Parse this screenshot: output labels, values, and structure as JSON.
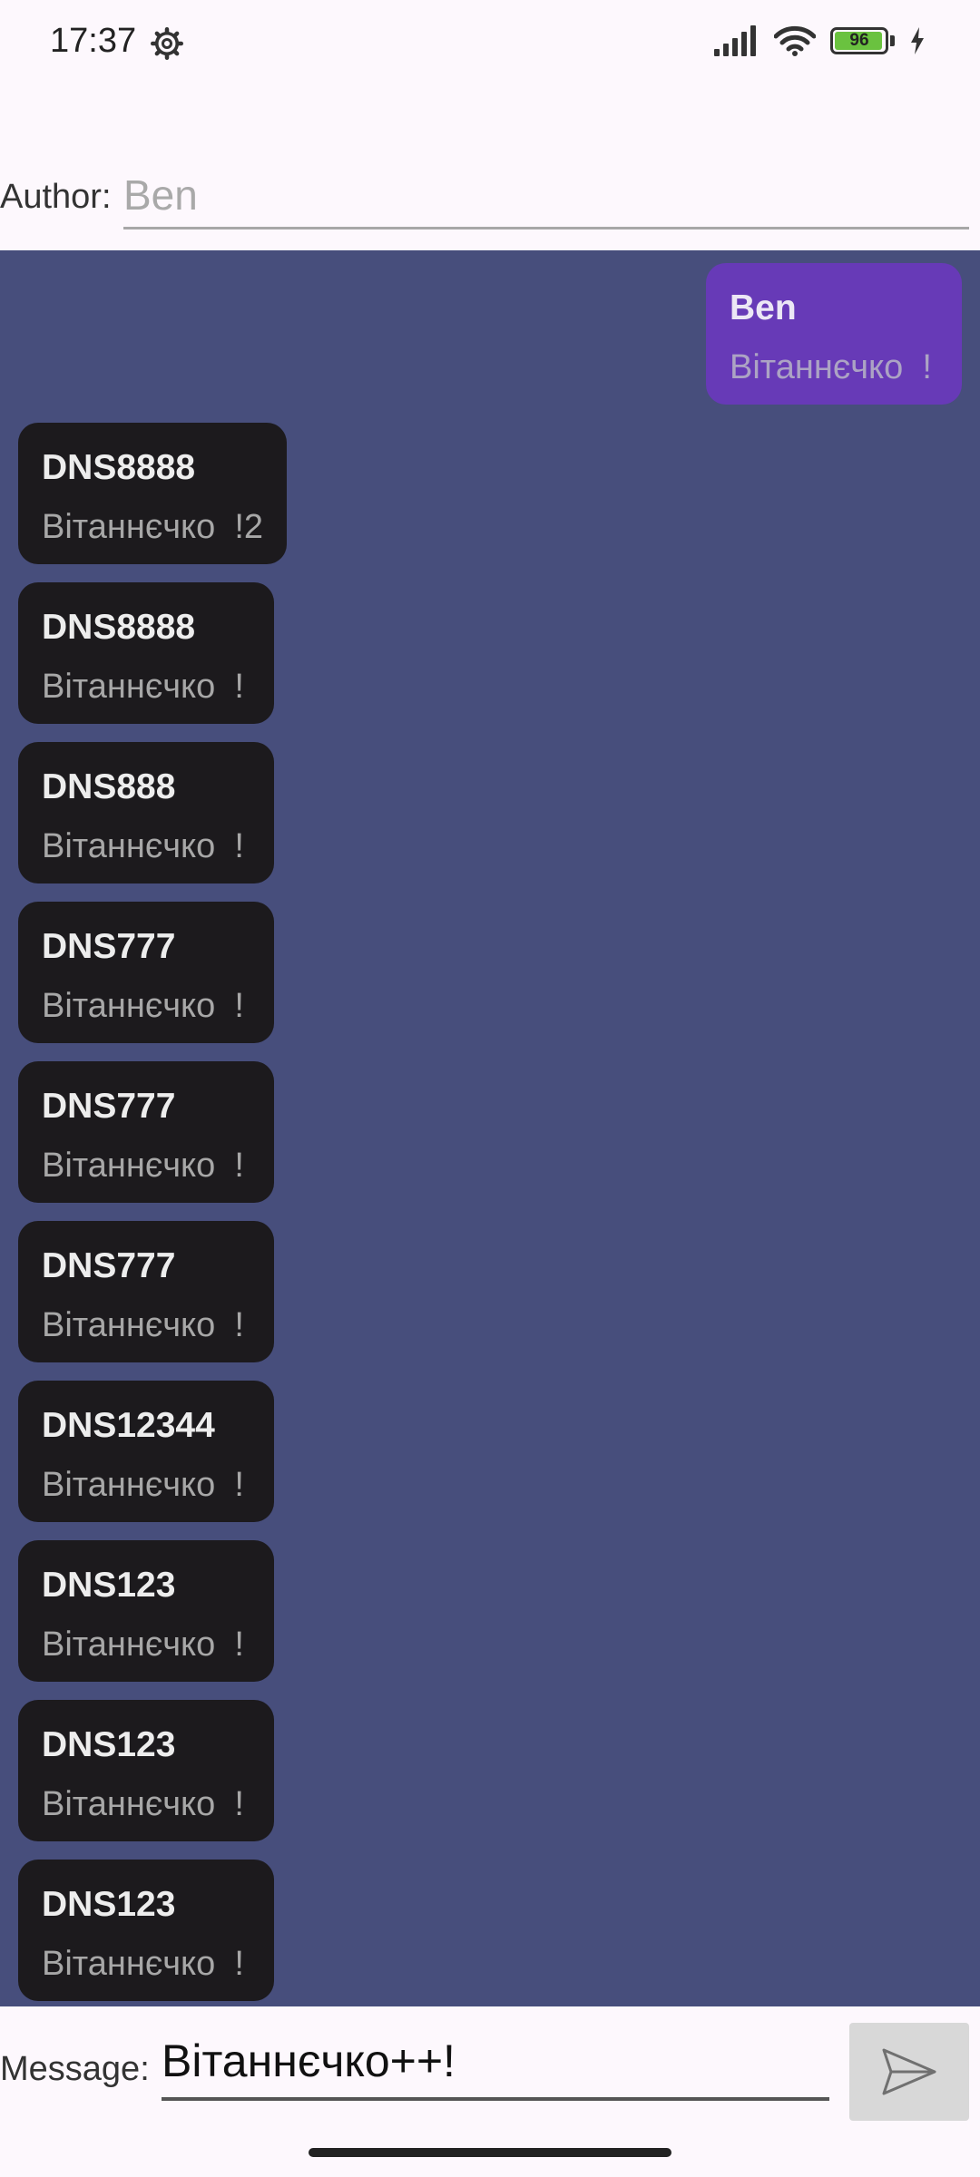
{
  "status_bar": {
    "time": "17:37",
    "battery_level": "96",
    "battery_fraction": 0.96,
    "icons": [
      "gear-icon",
      "signal-icon",
      "wifi-icon",
      "battery-icon",
      "charging-icon"
    ]
  },
  "author": {
    "label": "Author:",
    "placeholder": "Ben"
  },
  "messages": [
    {
      "author": "Ben",
      "text": "Вітаннєчко  !",
      "own": true
    },
    {
      "author": "DNS8888",
      "text": "Вітаннєчко  !2",
      "own": false
    },
    {
      "author": "DNS8888",
      "text": "Вітаннєчко  !",
      "own": false
    },
    {
      "author": "DNS888",
      "text": "Вітаннєчко  !",
      "own": false
    },
    {
      "author": "DNS777",
      "text": "Вітаннєчко  !",
      "own": false
    },
    {
      "author": "DNS777",
      "text": "Вітаннєчко  !",
      "own": false
    },
    {
      "author": "DNS777",
      "text": "Вітаннєчко  !",
      "own": false
    },
    {
      "author": "DNS12344",
      "text": "Вітаннєчко  !",
      "own": false
    },
    {
      "author": "DNS123",
      "text": "Вітаннєчко  !",
      "own": false
    },
    {
      "author": "DNS123",
      "text": "Вітаннєчко  !",
      "own": false
    },
    {
      "author": "DNS123",
      "text": "Вітаннєчко  !",
      "own": false
    }
  ],
  "composer": {
    "label": "Message:",
    "value": "Вітаннєчко++!",
    "send_icon": "send-icon"
  },
  "colors": {
    "chat_background": "#474e7c",
    "own_bubble": "#673ab7",
    "other_bubble": "#1c1a1d",
    "battery_fill": "#6ac23f"
  }
}
